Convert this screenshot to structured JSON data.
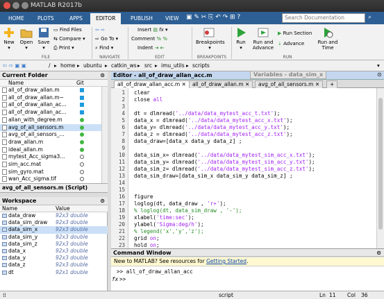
{
  "window": {
    "title": "MATLAB R2017b"
  },
  "ribbon_tabs": [
    "HOME",
    "PLOTS",
    "APPS",
    "EDITOR",
    "PUBLISH",
    "VIEW"
  ],
  "search": {
    "placeholder": "Search Documentation"
  },
  "ribbon": {
    "file": {
      "section": "FILE",
      "new": "New",
      "open": "Open",
      "save": "Save",
      "find_files": "Find Files",
      "compare": "Compare",
      "print": "Print"
    },
    "navigate": {
      "section": "NAVIGATE",
      "goto": "Go To",
      "find": "Find"
    },
    "edit": {
      "section": "EDIT",
      "insert": "Insert",
      "comment": "Comment",
      "indent": "Indent",
      "fx": "fx"
    },
    "breakpoints": {
      "section": "BREAKPOINTS",
      "label": "Breakpoints"
    },
    "run": {
      "section": "RUN",
      "run": "Run",
      "run_advance": "Run and Advance",
      "run_section": "Run Section",
      "advance": "Advance",
      "run_time": "Run and Time"
    }
  },
  "path": {
    "segments": [
      "/",
      "home",
      "ubuntu",
      "catkin_ws",
      "src",
      "imu_utils",
      "scripts"
    ]
  },
  "current_folder": {
    "title": "Current Folder",
    "col_name": "Name",
    "col_git": "Git",
    "files": [
      {
        "name": "all_of_draw_allan.m",
        "status": "blue"
      },
      {
        "name": "all_of_draw_allan.m~",
        "status": "blue"
      },
      {
        "name": "all_of_draw_allan_ac...",
        "status": "blue"
      },
      {
        "name": "all_of_draw_allan_ac...",
        "status": "blue"
      },
      {
        "name": "allan_with_degree.m",
        "status": "green"
      },
      {
        "name": "avg_of_all_sensors.m",
        "status": "green"
      },
      {
        "name": "avg_of_all_sensors_...",
        "status": "green"
      },
      {
        "name": "draw_allan.m",
        "status": "green"
      },
      {
        "name": "ideal_allan.m",
        "status": "green"
      },
      {
        "name": "mytest_Acc_sigma3...",
        "status": "circle"
      },
      {
        "name": "sim_acc.mat",
        "status": "circle"
      },
      {
        "name": "sim_gyro.mat",
        "status": "circle"
      },
      {
        "name": "wan_Acc_sigma.tif",
        "status": "circle"
      }
    ]
  },
  "details": {
    "title": "avg_of_all_sensors.m (Script)"
  },
  "workspace": {
    "title": "Workspace",
    "col_name": "Name",
    "col_value": "Value",
    "vars": [
      {
        "name": "data_draw",
        "value": "92x3 double"
      },
      {
        "name": "data_sim_draw",
        "value": "92x3 double"
      },
      {
        "name": "data_sim_x",
        "value": "92x3 double"
      },
      {
        "name": "data_sim_y",
        "value": "92x3 double"
      },
      {
        "name": "data_sim_z",
        "value": "92x3 double"
      },
      {
        "name": "data_x",
        "value": "92x3 double"
      },
      {
        "name": "data_y",
        "value": "92x3 double"
      },
      {
        "name": "data_z",
        "value": "92x3 double"
      },
      {
        "name": "dt",
        "value": "92x1 double"
      }
    ]
  },
  "editor": {
    "header": "Editor - all_of_draw_allan_acc.m",
    "variables_tab": "Variables - data_sim_x",
    "tabs": [
      "all_of_draw_allan_acc.m",
      "all_of_draw_allan.m",
      "avg_of_all_sensors.m"
    ],
    "add_tab": "+",
    "lines": [
      {
        "n": "1",
        "segs": [
          {
            "t": "clear",
            "c": ""
          }
        ]
      },
      {
        "n": "2",
        "segs": [
          {
            "t": "close ",
            "c": ""
          },
          {
            "t": "all",
            "c": "str"
          }
        ]
      },
      {
        "n": "3",
        "segs": []
      },
      {
        "n": "4",
        "segs": [
          {
            "t": "dt = dlmread(",
            "c": ""
          },
          {
            "t": "'../data/data_mytest_acc_t.txt'",
            "c": "str"
          },
          {
            "t": ");",
            "c": ""
          }
        ]
      },
      {
        "n": "5",
        "segs": [
          {
            "t": "data_x = dlmread(",
            "c": ""
          },
          {
            "t": "'../data/data_mytest_acc_x.txt'",
            "c": "str"
          },
          {
            "t": ");",
            "c": ""
          }
        ]
      },
      {
        "n": "6",
        "segs": [
          {
            "t": "data_y= dlmread(",
            "c": ""
          },
          {
            "t": "'../data/data_mytest_acc_y.txt'",
            "c": "str"
          },
          {
            "t": ");",
            "c": ""
          }
        ]
      },
      {
        "n": "7",
        "segs": [
          {
            "t": "data_z = dlmread(",
            "c": ""
          },
          {
            "t": "'../data/data_mytest_acc_z.txt'",
            "c": "str"
          },
          {
            "t": ");",
            "c": ""
          }
        ]
      },
      {
        "n": "8",
        "segs": [
          {
            "t": "data_draw=[data_x data_y data_z] ;",
            "c": ""
          }
        ]
      },
      {
        "n": "9",
        "segs": []
      },
      {
        "n": "10",
        "segs": [
          {
            "t": "data_sim_x= dlmread(",
            "c": ""
          },
          {
            "t": "'../data/data_mytest_sim_acc_x.txt'",
            "c": "str"
          },
          {
            "t": ");",
            "c": ""
          }
        ]
      },
      {
        "n": "11",
        "segs": [
          {
            "t": "data_sim_y= dlmread(",
            "c": ""
          },
          {
            "t": "'../data/data_mytest_sim_acc_y.txt'",
            "c": "str"
          },
          {
            "t": ");",
            "c": ""
          }
        ]
      },
      {
        "n": "12",
        "segs": [
          {
            "t": "data_sim_z= dlmread(",
            "c": ""
          },
          {
            "t": "'../data/data_mytest_sim_acc_z.txt'",
            "c": "str"
          },
          {
            "t": ");",
            "c": ""
          }
        ]
      },
      {
        "n": "13",
        "segs": [
          {
            "t": "data_sim_draw=[data_sim_x data_sim_y data_sim_z] ;",
            "c": ""
          }
        ]
      },
      {
        "n": "14",
        "segs": []
      },
      {
        "n": "15",
        "segs": []
      },
      {
        "n": "16",
        "segs": [
          {
            "t": "figure",
            "c": ""
          }
        ]
      },
      {
        "n": "17",
        "segs": [
          {
            "t": "loglog(dt, data_draw , ",
            "c": ""
          },
          {
            "t": "'r+'",
            "c": "str"
          },
          {
            "t": ");",
            "c": ""
          }
        ]
      },
      {
        "n": "18",
        "segs": [
          {
            "t": "% loglog(dt, data_sim_draw , '-');",
            "c": "cmt"
          }
        ]
      },
      {
        "n": "19",
        "segs": [
          {
            "t": "xlabel(",
            "c": ""
          },
          {
            "t": "'time:sec'",
            "c": "str"
          },
          {
            "t": ");",
            "c": ""
          }
        ]
      },
      {
        "n": "20",
        "segs": [
          {
            "t": "ylabel(",
            "c": ""
          },
          {
            "t": "'Sigma:deg/h'",
            "c": "str"
          },
          {
            "t": ");",
            "c": ""
          }
        ]
      },
      {
        "n": "21",
        "segs": [
          {
            "t": "% legend('x','y','z');",
            "c": "cmt"
          }
        ]
      },
      {
        "n": "22",
        "segs": [
          {
            "t": "grid ",
            "c": ""
          },
          {
            "t": "on",
            "c": "str"
          },
          {
            "t": ";",
            "c": ""
          }
        ]
      },
      {
        "n": "23",
        "segs": [
          {
            "t": "hold ",
            "c": ""
          },
          {
            "t": "on",
            "c": "str"
          },
          {
            "t": ";",
            "c": ""
          }
        ]
      }
    ]
  },
  "command_window": {
    "title": "Command Window",
    "new_text": "New to MATLAB? See resources for ",
    "link": "Getting Started",
    "link_end": ".",
    "history": ">> all_of_draw_allan_acc",
    "prompt_fx": "fx",
    "prompt": ">>"
  },
  "status": {
    "type": "script",
    "ln_label": "Ln",
    "ln": "11",
    "col_label": "Col",
    "col": "36"
  },
  "colors": {
    "tab_blue": "#2d5f95",
    "accent": "#0072bd",
    "git_blue": "#1f9bde",
    "git_green": "#41b642"
  }
}
